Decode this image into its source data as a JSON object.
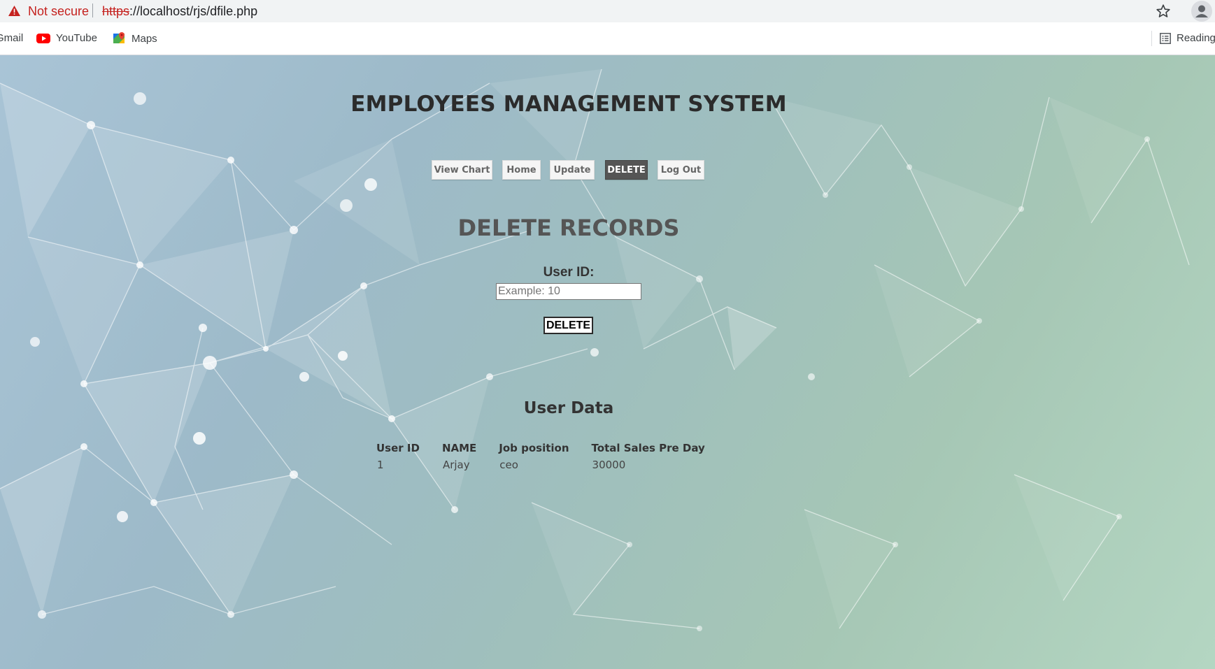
{
  "browser": {
    "security_label": "Not secure",
    "url_scheme": "https",
    "url_rest": "://localhost/rjs/dfile.php",
    "bookmarks": [
      {
        "label": "Gmail",
        "icon": "gmail-icon"
      },
      {
        "label": "YouTube",
        "icon": "youtube-icon"
      },
      {
        "label": "Maps",
        "icon": "maps-icon"
      }
    ],
    "reading_list_label": "Reading list"
  },
  "page": {
    "site_title": "EMPLOYEES MANAGEMENT SYSTEM",
    "nav": [
      {
        "label": "View Chart",
        "active": false
      },
      {
        "label": "Home",
        "active": false
      },
      {
        "label": "Update",
        "active": false
      },
      {
        "label": "DELETE",
        "active": true
      },
      {
        "label": "Log Out",
        "active": false
      }
    ],
    "section_title": "DELETE RECORDS",
    "form": {
      "user_id_label": "User ID:",
      "user_id_value": "",
      "user_id_placeholder": "Example: 10",
      "submit_label": "DELETE"
    },
    "data_title": "User Data",
    "table": {
      "headers": [
        "User ID",
        "NAME",
        "Job position",
        "Total Sales Pre Day"
      ],
      "rows": [
        [
          "1",
          "Arjay",
          "ceo",
          "30000"
        ]
      ]
    }
  },
  "colors": {
    "nav_active_bg": "#555555",
    "warning_red": "#c5221f",
    "background_blue": "#a9c4d6",
    "background_green": "#b4d6c2"
  }
}
